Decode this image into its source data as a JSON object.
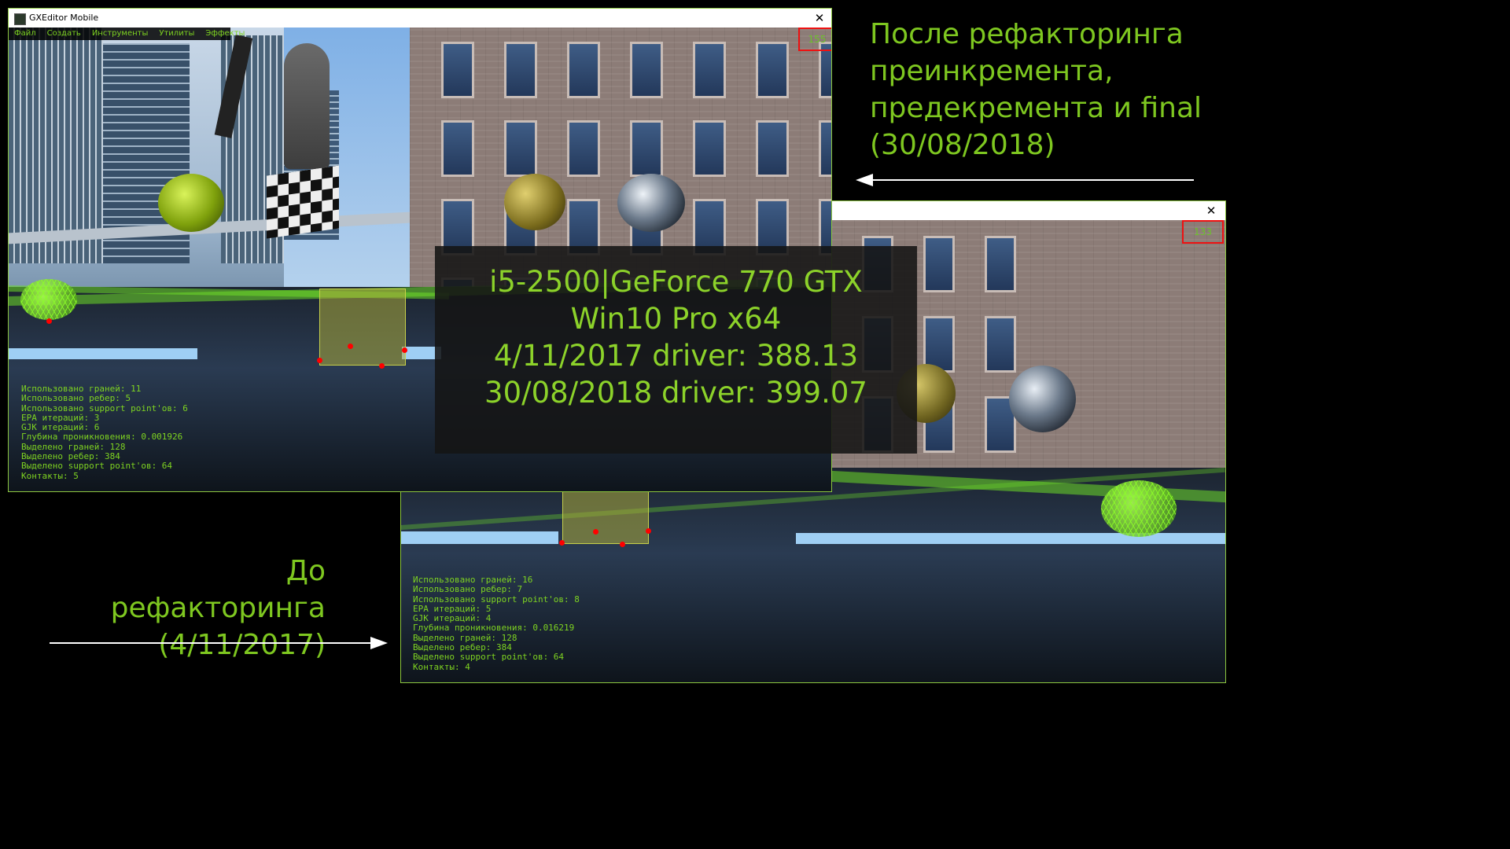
{
  "window_top": {
    "title": "GXEditor Mobile",
    "menu": [
      "Файл",
      "Создать",
      "Инструменты",
      "Утилиты",
      "Эффекты"
    ],
    "fps": "155",
    "stats": [
      "Использовано граней: 11",
      "Использовано ребер: 5",
      "Использовано support point'ов: 6",
      "EPA итераций: 3",
      "GJK итераций: 6",
      "Глубина проникновения: 0.001926",
      "Выделено граней: 128",
      "Выделено ребер: 384",
      "Выделено support point'ов: 64",
      "Контакты: 5"
    ]
  },
  "window_bottom": {
    "fps": "133",
    "stats": [
      "Использовано граней: 16",
      "Использовано ребер: 7",
      "Использовано support point'ов: 8",
      "EPA итераций: 5",
      "GJK итераций: 4",
      "Глубина проникновения: 0.016219",
      "Выделено граней: 128",
      "Выделено ребер: 384",
      "Выделено support point'ов: 64",
      "Контакты: 4"
    ]
  },
  "system_info": [
    "i5-2500|GeForce 770 GTX",
    "Win10 Pro x64",
    "4/11/2017 driver: 388.13",
    "30/08/2018 driver: 399.07"
  ],
  "caption_after": [
    "После рефакторинга",
    "преинкремента,",
    "предекремента и final",
    "(30/08/2018)"
  ],
  "caption_before": [
    "До рефакторинга",
    "(4/11/2017)"
  ],
  "colors": {
    "accent_green": "#7ec720",
    "fps_box": "#e11111"
  }
}
